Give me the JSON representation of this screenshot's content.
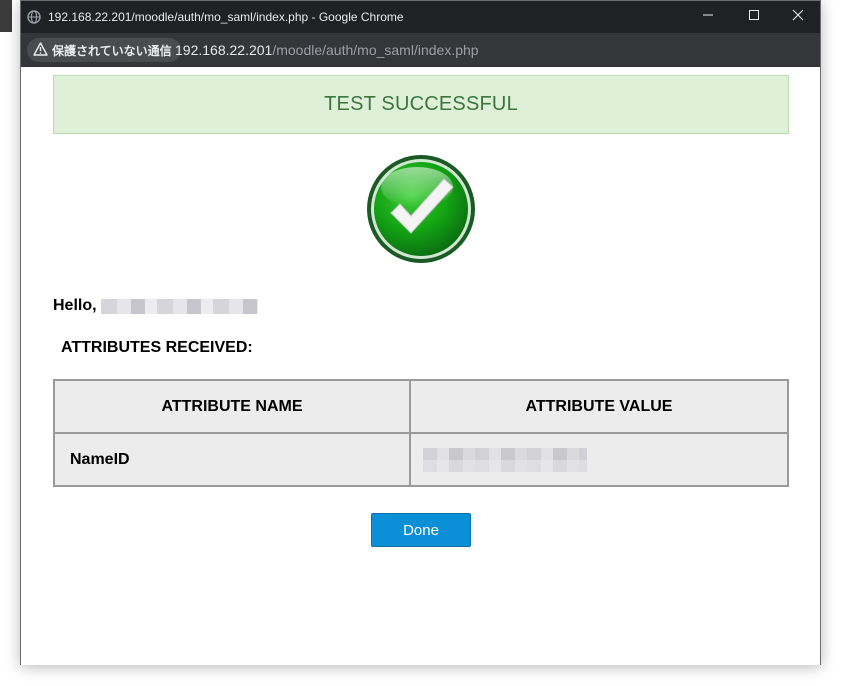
{
  "browser": {
    "window_title": "192.168.22.201/moodle/auth/mo_saml/index.php - Google Chrome",
    "security_label": "保護されていない通信",
    "url_host": "192.168.22.201",
    "url_path": "/moodle/auth/mo_saml/index.php",
    "icons": {
      "page": "globe-icon",
      "warning": "warning-triangle-icon",
      "minimize": "minimize-icon",
      "maximize": "maximize-icon",
      "close": "close-icon"
    }
  },
  "result": {
    "banner_text": "TEST SUCCESSFUL",
    "banner_bg": "#dff0d8",
    "banner_color": "#3c763d",
    "status_icon": "success-checkmark-icon"
  },
  "greeting": {
    "prefix": "Hello,"
  },
  "attributes": {
    "heading": "ATTRIBUTES RECEIVED:",
    "columns": [
      "ATTRIBUTE NAME",
      "ATTRIBUTE VALUE"
    ],
    "rows": [
      {
        "name": "NameID"
      }
    ]
  },
  "actions": {
    "done_label": "Done",
    "done_color": "#0b8fd6"
  }
}
